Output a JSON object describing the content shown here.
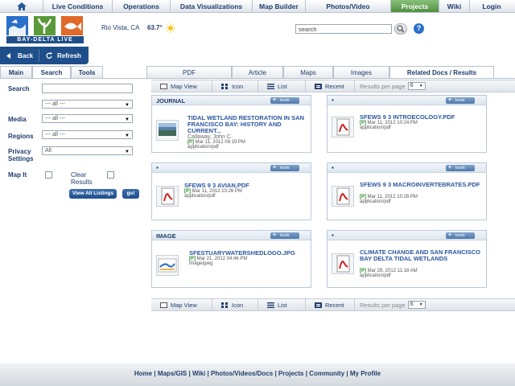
{
  "topnav": {
    "items": [
      {
        "label": "Live Conditions",
        "active": false
      },
      {
        "label": "Operations",
        "active": false
      },
      {
        "label": "Data Visualizations",
        "active": false
      },
      {
        "label": "Map Builder",
        "active": false
      },
      {
        "label": "Photos/Video",
        "active": false
      },
      {
        "label": "Projects",
        "active": true
      },
      {
        "label": "Wiki",
        "active": false
      },
      {
        "label": "Login",
        "active": false
      }
    ],
    "home_icon": "home-icon",
    "active_color": "#5a9a4a"
  },
  "brand": {
    "logo_text": "BAY-DELTA LIVE",
    "location": "Rio Vista, CA",
    "temperature": "63.7°",
    "weather_icon": "sun-icon"
  },
  "search": {
    "value": "search",
    "button_icon": "search-icon",
    "help_icon": "help-icon",
    "help_label": "?"
  },
  "actions": {
    "back_label": "Back",
    "refresh_label": "Refresh"
  },
  "sidebar": {
    "tabs": [
      {
        "label": "Main",
        "active": false
      },
      {
        "label": "Search",
        "active": true
      },
      {
        "label": "Tools",
        "active": false
      }
    ],
    "search_label": "Search",
    "search_value": "",
    "type_select": "--- all ---",
    "media_label": "Media",
    "media_select": "--- all ---",
    "regions_label": "Regions",
    "regions_select": "--- all ---",
    "privacy_label": "Privacy Settings",
    "privacy_select": "All",
    "mapit_label": "Map It",
    "clear_results_label": "Clear Results",
    "view_all_label": "View All Listings",
    "go_label": "go!"
  },
  "content_tabs": [
    {
      "label": "PDF",
      "active": false
    },
    {
      "label": "Article",
      "active": false
    },
    {
      "label": "Maps",
      "active": false
    },
    {
      "label": "Images",
      "active": false
    },
    {
      "label": "Related Docs / Results",
      "active": true
    }
  ],
  "viewbar": {
    "map_view": "Map View",
    "icon": "Icon",
    "list": "List",
    "recent": "Recent",
    "results_per_page_label": "Results per page",
    "results_per_page": "6"
  },
  "cards": [
    {
      "type": "JOURNAL",
      "title": "TIDAL WETLAND RESTORATION IN SAN FRANCISCO BAY: HISTORY AND CURRENT...",
      "author": "Callaway, John C.",
      "flag": "[P]",
      "date": "Mar 11, 2012 08:19 PM",
      "mime": "application/pdf",
      "icon": "photo-thumbnail-icon",
      "tools_label": "tools"
    },
    {
      "type": "*",
      "title": "SFEWS 9 3 INTROECOLOGY.PDF",
      "author": "",
      "flag": "[P]",
      "date": "Mar 11, 2012 10:24 PM",
      "mime": "application/pdf",
      "icon": "pdf-icon",
      "tools_label": "tools"
    },
    {
      "type": "*",
      "title": "SFEWS 9 3 AVIAN.PDF",
      "author": "",
      "flag": "[P]",
      "date": "Mar 11, 2012 10:26 PM",
      "mime": "application/pdf",
      "icon": "pdf-icon",
      "tools_label": "tools"
    },
    {
      "type": "*",
      "title": "SFEWS 9 3 MACROINVERTEBRATES.PDF",
      "author": "",
      "flag": "[P]",
      "date": "Mar 11, 2012 10:28 PM",
      "mime": "application/pdf",
      "icon": "pdf-icon",
      "tools_label": "tools"
    },
    {
      "type": "IMAGE",
      "title": "SFESTUARYWATERSHEDLOGO.JPG",
      "author": "",
      "flag": "[P]",
      "date": "Mar 21, 2012 04:46 PM",
      "mime": "image/jpeg",
      "icon": "image-thumbnail-icon",
      "tools_label": "tools"
    },
    {
      "type": "*",
      "title": "CLIMATE CHANGE AND SAN FRANCISCO BAY DELTA TIDAL WETLANDS",
      "author": "",
      "flag": "[P]",
      "date": "Mar 28, 2012 11:18 AM",
      "mime": "application/pdf",
      "icon": "pdf-icon",
      "tools_label": "tools"
    }
  ],
  "footer": {
    "links": [
      "Home",
      "Maps/GIS",
      "Wiki",
      "Photos/Videos/Docs",
      "Projects",
      "Community",
      "My Profile"
    ],
    "separator": " | "
  }
}
